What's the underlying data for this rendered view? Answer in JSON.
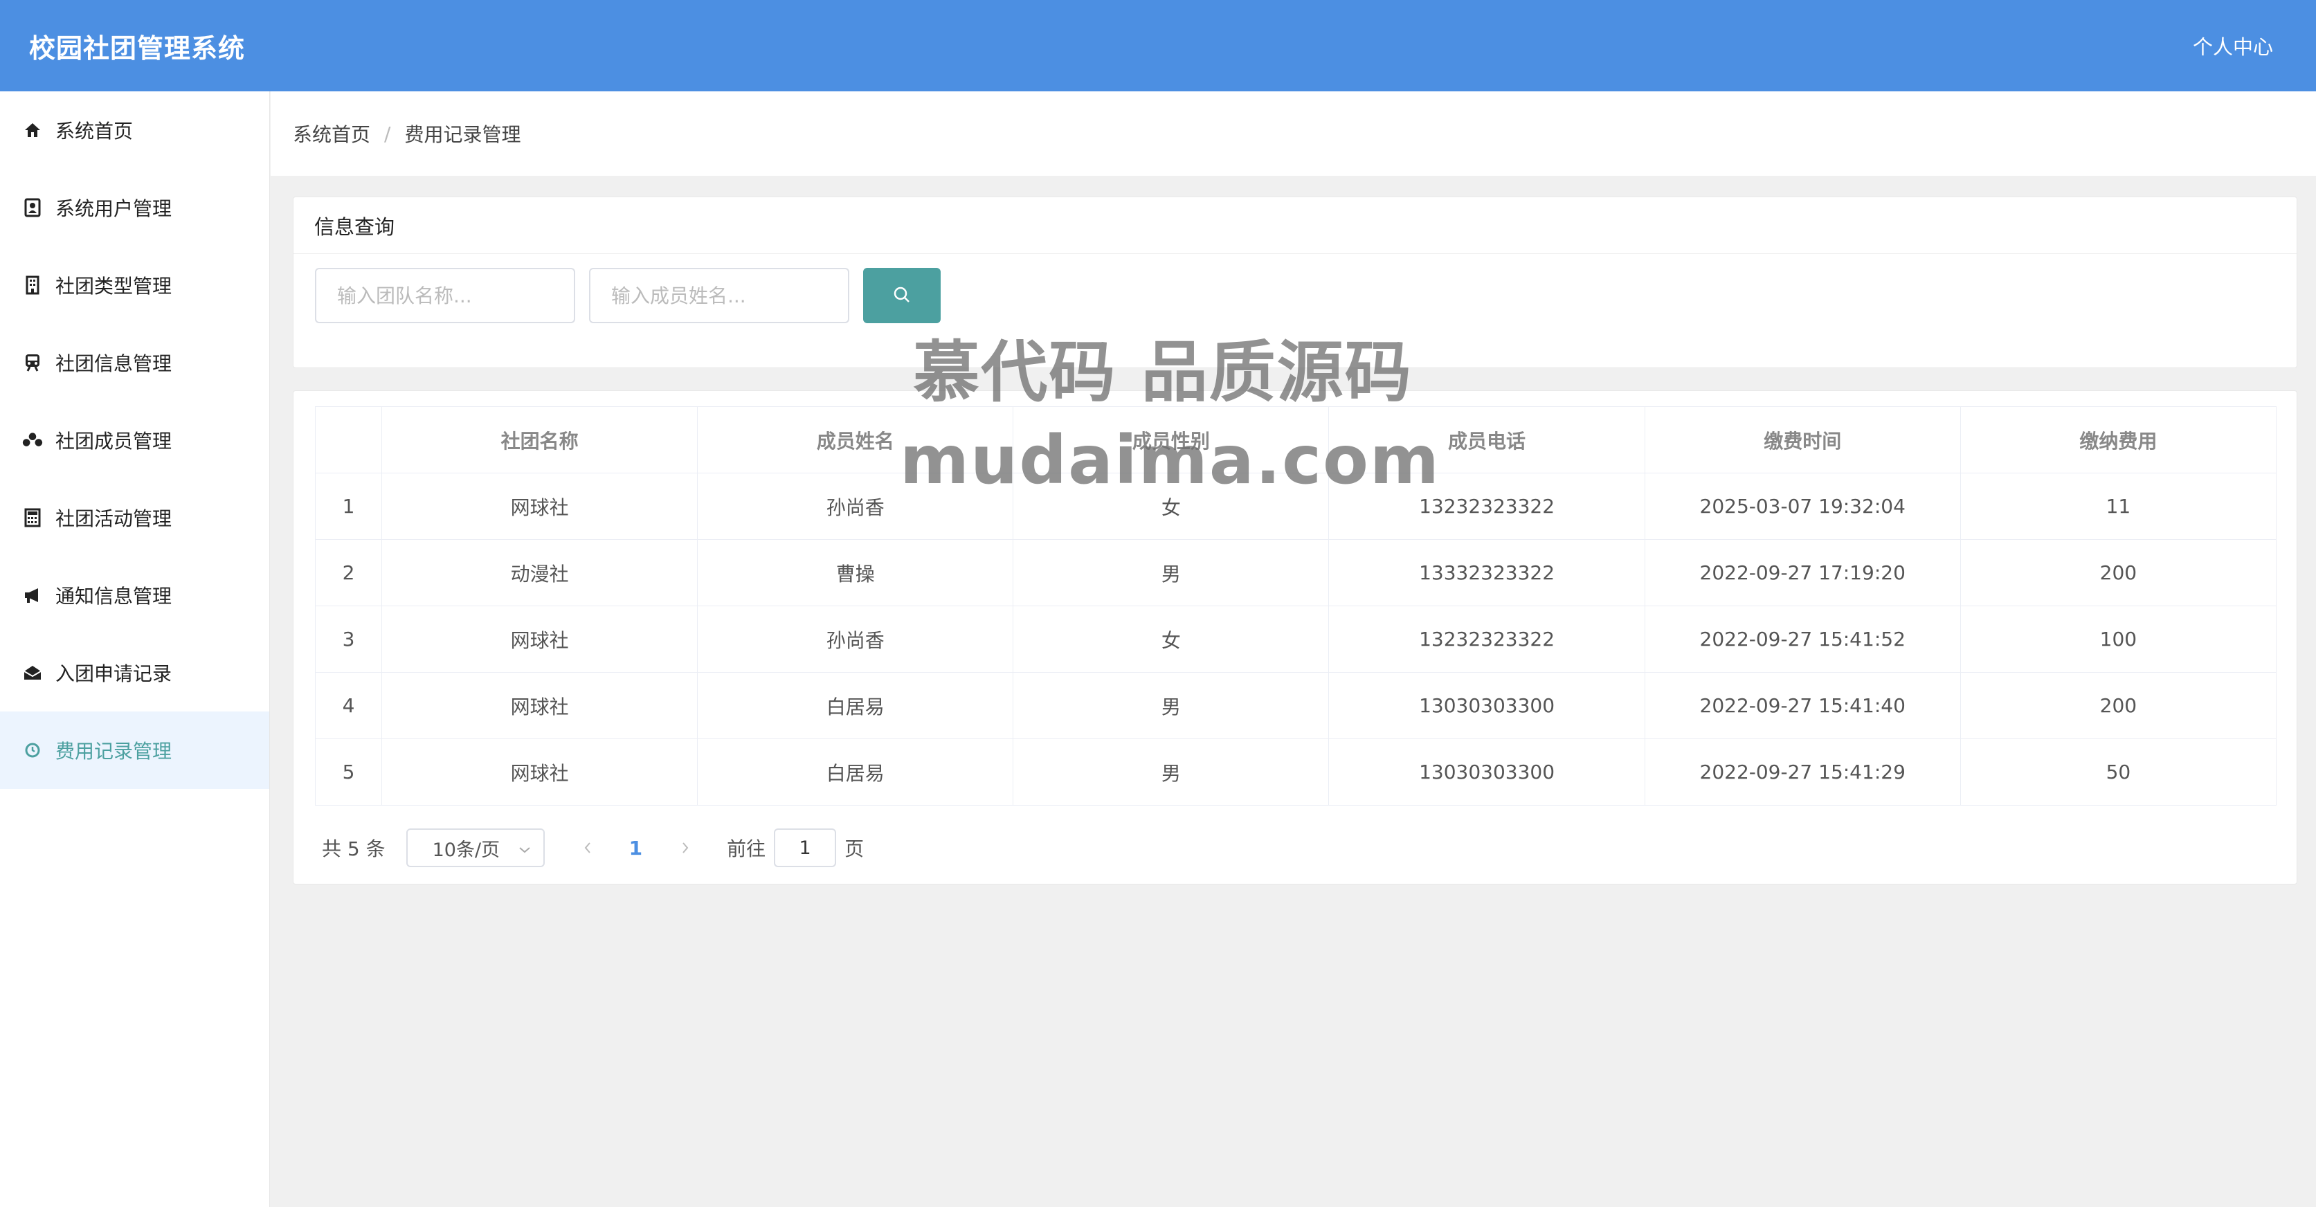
{
  "header": {
    "title": "校园社团管理系统",
    "user_center": "个人中心"
  },
  "sidebar": {
    "items": [
      {
        "label": "系统首页",
        "icon": "home-icon"
      },
      {
        "label": "系统用户管理",
        "icon": "user-card-icon"
      },
      {
        "label": "社团类型管理",
        "icon": "building-icon"
      },
      {
        "label": "社团信息管理",
        "icon": "train-icon"
      },
      {
        "label": "社团成员管理",
        "icon": "users-icon"
      },
      {
        "label": "社团活动管理",
        "icon": "calculator-icon"
      },
      {
        "label": "通知信息管理",
        "icon": "megaphone-icon"
      },
      {
        "label": "入团申请记录",
        "icon": "envelope-icon"
      },
      {
        "label": "费用记录管理",
        "icon": "clock-icon",
        "active": true
      }
    ]
  },
  "breadcrumb": {
    "home": "系统首页",
    "separator": "/",
    "current": "费用记录管理"
  },
  "query": {
    "title": "信息查询",
    "team_placeholder": "输入团队名称...",
    "member_placeholder": "输入成员姓名...",
    "search_icon": "search-icon"
  },
  "table": {
    "columns": [
      "",
      "社团名称",
      "成员姓名",
      "成员性别",
      "成员电话",
      "缴费时间",
      "缴纳费用"
    ],
    "rows": [
      [
        "1",
        "网球社",
        "孙尚香",
        "女",
        "13232323322",
        "2025-03-07 19:32:04",
        "11"
      ],
      [
        "2",
        "动漫社",
        "曹操",
        "男",
        "13332323322",
        "2022-09-27 17:19:20",
        "200"
      ],
      [
        "3",
        "网球社",
        "孙尚香",
        "女",
        "13232323322",
        "2022-09-27 15:41:52",
        "100"
      ],
      [
        "4",
        "网球社",
        "白居易",
        "男",
        "13030303300",
        "2022-09-27 15:41:40",
        "200"
      ],
      [
        "5",
        "网球社",
        "白居易",
        "男",
        "13030303300",
        "2022-09-27 15:41:29",
        "50"
      ]
    ]
  },
  "pagination": {
    "total": "共 5 条",
    "page_size": "10条/页",
    "current_page": "1",
    "goto_label": "前往",
    "goto_value": "1",
    "goto_suffix": "页"
  },
  "watermark": {
    "line1": "慕代码 品质源码",
    "line2": "mudaima.com"
  },
  "colors": {
    "header": "#4c8fe2",
    "accent": "#4ca0a0",
    "active_bg": "#ecf4fe"
  }
}
